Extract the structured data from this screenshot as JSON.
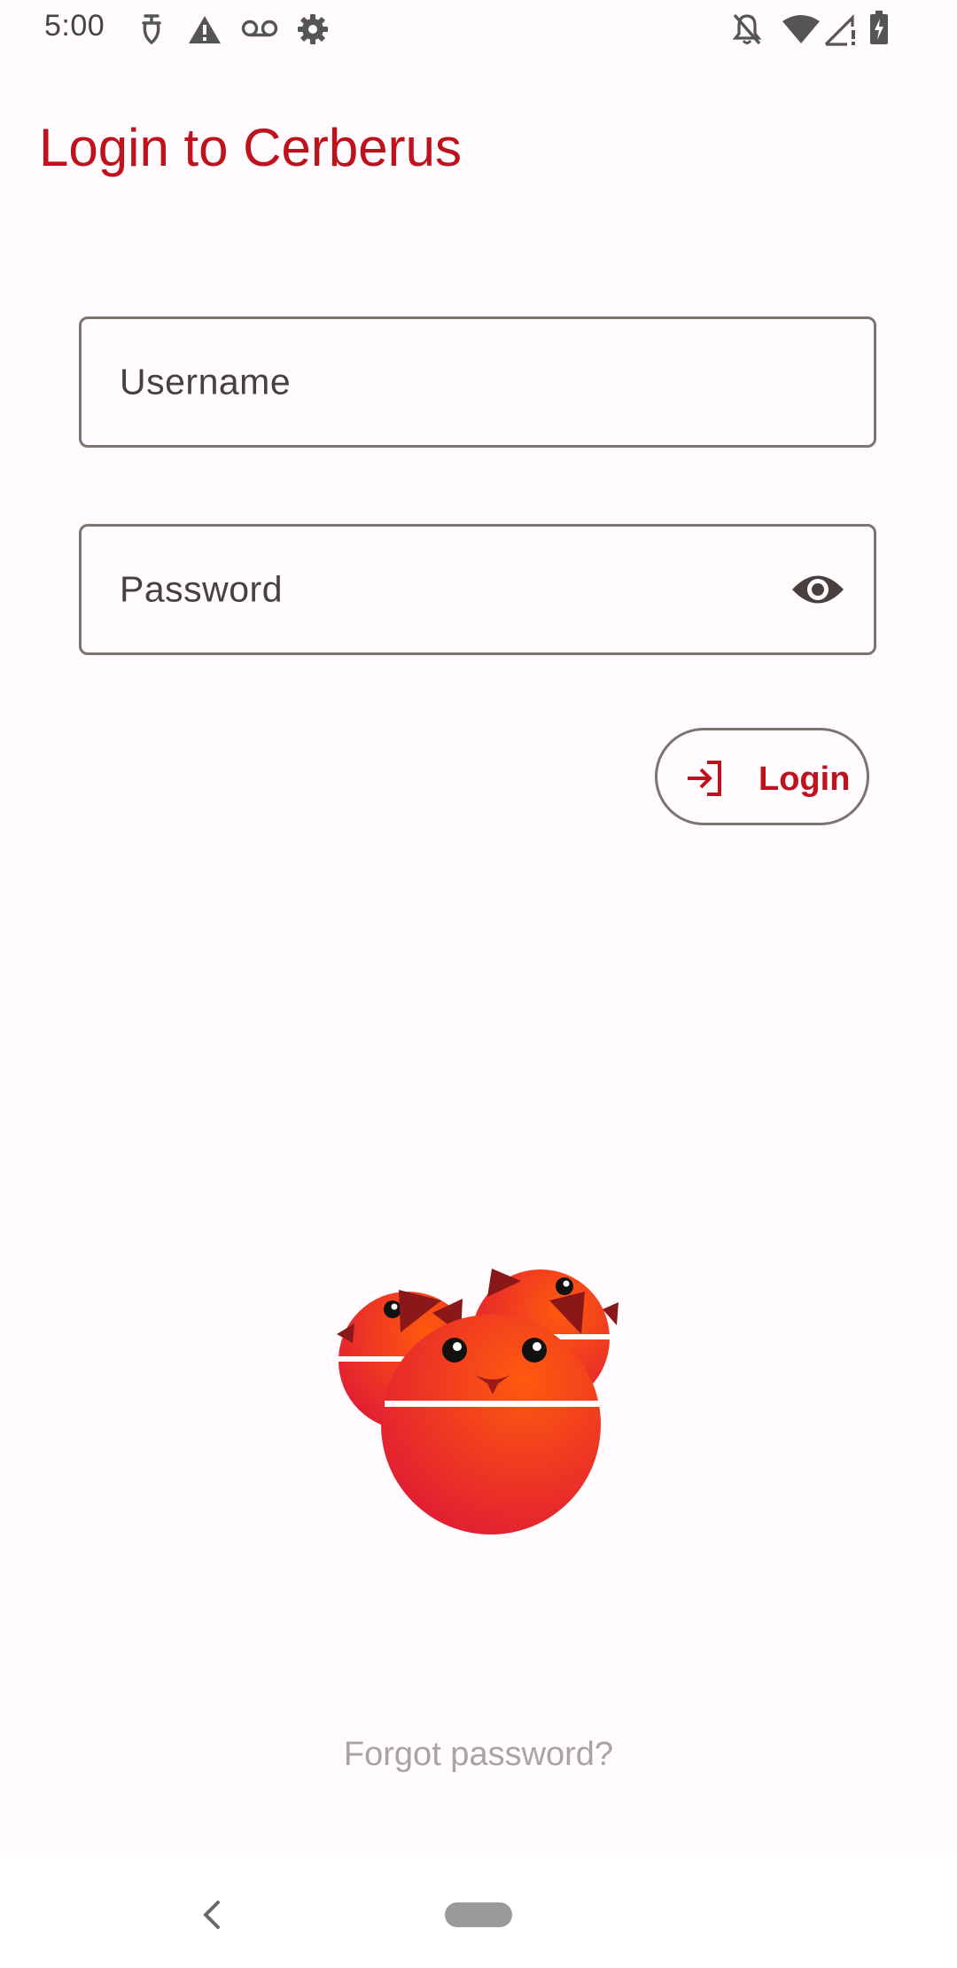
{
  "status_bar": {
    "time": "5:00",
    "left_icons": [
      "assistant-icon",
      "warning-icon",
      "voicemail-icon",
      "settings-gear-icon"
    ],
    "right_icons": [
      "notifications-off-icon",
      "wifi-icon",
      "signal-no-connection-icon",
      "battery-charging-icon"
    ]
  },
  "header": {
    "title": "Login to Cerberus"
  },
  "form": {
    "username_label": "Username",
    "password_label": "Password",
    "password_toggle_icon": "eye-icon",
    "login_label": "Login",
    "login_icon": "login-arrow-icon"
  },
  "mascot": {
    "icon": "cerberus-three-heads-logo"
  },
  "footer": {
    "forgot_label": "Forgot password?"
  },
  "nav": {
    "back_icon": "back-chevron-icon",
    "home_icon": "home-pill-icon"
  },
  "colors": {
    "accent": "#c0121c",
    "outline": "#7d7370",
    "background": "#fffbfe",
    "muted_text": "#a9a4a3"
  }
}
